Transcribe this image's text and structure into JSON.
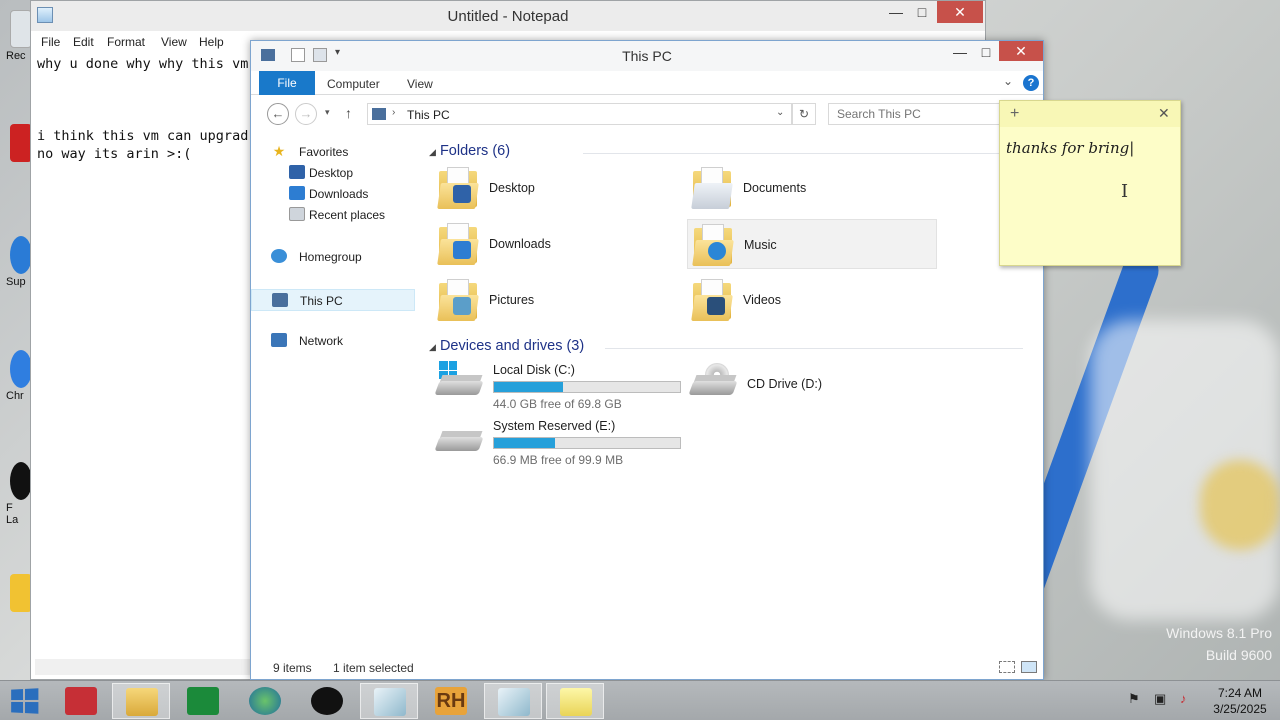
{
  "desktop": {
    "watermark_line1": "Windows 8.1 Pro",
    "watermark_line2": "Build 9600",
    "icon_labels": [
      "Rec",
      "",
      "Sup",
      "Chr",
      "F\nLa"
    ]
  },
  "notepad": {
    "title": "Untitled - Notepad",
    "menu": [
      "File",
      "Edit",
      "Format",
      "View",
      "Help"
    ],
    "text": "why u done why why this vm\n\n\n\ni think this vm can upgrad\nno way its arin >:("
  },
  "explorer": {
    "title": "This PC",
    "ribbon_tabs": [
      "File",
      "Computer",
      "View"
    ],
    "address": "This PC",
    "search_placeholder": "Search This PC",
    "nav": {
      "favorites": "Favorites",
      "desktop": "Desktop",
      "downloads": "Downloads",
      "recent": "Recent places",
      "homegroup": "Homegroup",
      "thispc": "This PC",
      "network": "Network"
    },
    "folders_header": "Folders (6)",
    "folders": [
      "Desktop",
      "Documents",
      "Downloads",
      "Music",
      "Pictures",
      "Videos"
    ],
    "devices_header": "Devices and drives (3)",
    "drives": [
      {
        "name": "Local Disk (C:)",
        "free": "44.0 GB free of 69.8 GB",
        "used_fraction": 0.37
      },
      {
        "name": "System Reserved (E:)",
        "free": "66.9 MB free of 99.9 MB",
        "used_fraction": 0.33
      }
    ],
    "cd_drive": "CD Drive (D:)",
    "status_items": "9 items",
    "status_selected": "1 item selected"
  },
  "sticky": {
    "text": "thanks for bring"
  },
  "taskbar": {
    "time": "7:24 AM",
    "date": "3/25/2025",
    "apps": [
      "winrar-icon",
      "file-explorer-icon",
      "store-icon",
      "globe-icon",
      "app-black-icon",
      "app-glass-icon",
      "rh-app-icon",
      "app-glass-icon",
      "sticky-notes-icon"
    ],
    "rh_label": "RH"
  }
}
